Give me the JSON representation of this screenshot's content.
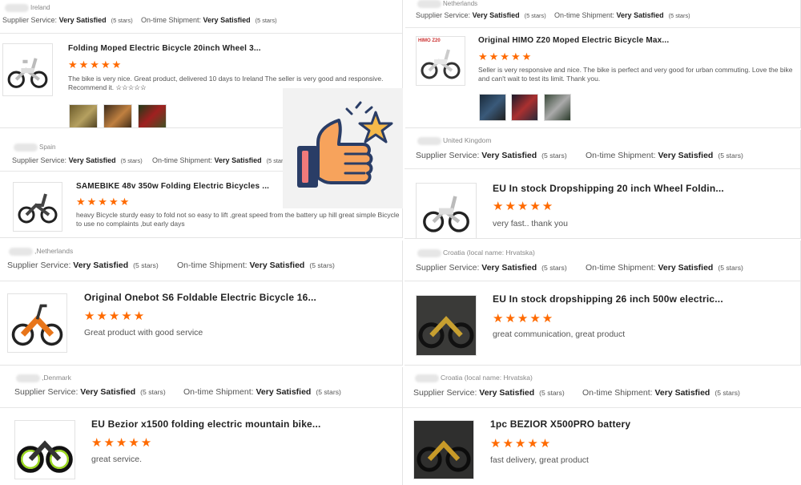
{
  "service_label": "Supplier Service:",
  "shipment_label": "On-time Shipment:",
  "satisfied": "Very Satisfied",
  "five_stars": "(5 stars)",
  "star_glyphs": "★★★★★",
  "cards": [
    {
      "location": "Ireland",
      "title": "Folding Moped Electric Bicycle 20inch Wheel 3...",
      "review": "The bike is very nice. Great product, delivered 10 days  to Ireland",
      "review2": "The seller is very good and responsive. Recommend it.",
      "photo_count": 3
    },
    {
      "location": "Netherlands",
      "title": "Original HIMO Z20 Moped Electric Bicycle Max...",
      "review": "Seller is very responsive and nice. The bike is perfect and very good for urban commuting. Love the bike and can't wait to test its limit. Thank you.",
      "brand_tag": "HIMO Z20",
      "photo_count": 3
    },
    {
      "location": "Spain",
      "title": "SAMEBIKE 48v 350w Folding Electric Bicycles ...",
      "review": "heavy Bicycle sturdy easy to fold not so easy to lift ,great speed from the battery up hill great simple Bicycle to use no complaints ,but early days"
    },
    {
      "location": "United Kingdom",
      "title": "EU In stock Dropshipping 20 inch Wheel Foldin...",
      "review": "very fast.. thank you"
    },
    {
      "location": ",Netherlands",
      "title": "Original Onebot S6 Foldable Electric Bicycle 16...",
      "review": "Great product with good service"
    },
    {
      "location": "Croatia (local name: Hrvatska)",
      "title": "EU In stock dropshipping 26 inch 500w electric...",
      "review": "great communication, great product"
    },
    {
      "location": ",Denmark",
      "title": "EU Bezior x1500 folding electric mountain bike...",
      "review": "great service."
    },
    {
      "location": "Croatia (local name: Hrvatska)",
      "title": "1pc BEZIOR X500PRO battery",
      "review": "fast delivery, great product"
    }
  ],
  "icon_names": {
    "thumbs_up": "thumbs-up-icon",
    "star": "star-icon",
    "bike": "bike-icon"
  },
  "colors": {
    "star_orange": "#ff6a00",
    "thumb_orange": "#f7a35c",
    "thumb_navy": "#2a3d66"
  }
}
